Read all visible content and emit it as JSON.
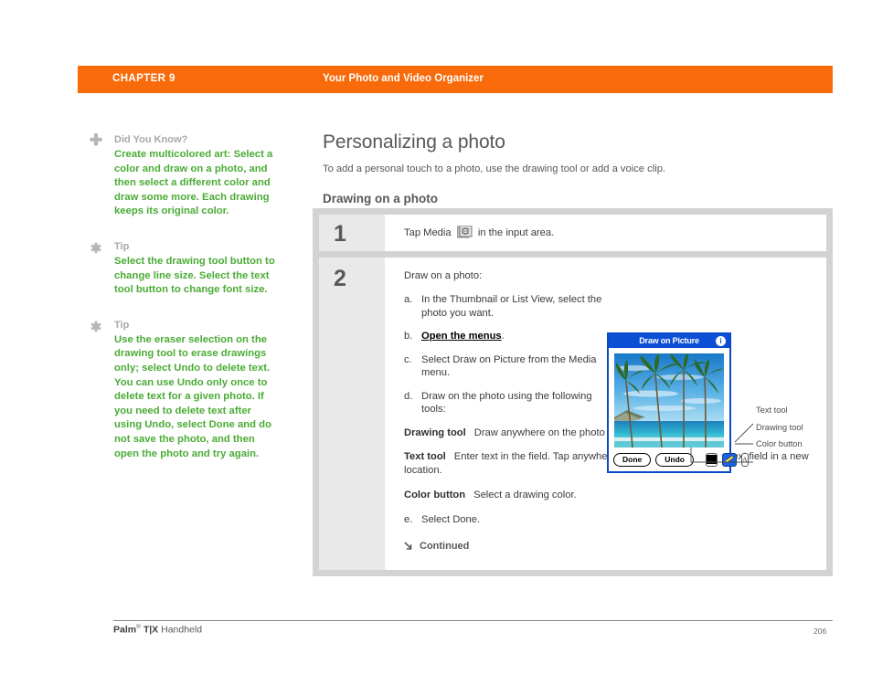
{
  "header": {
    "chapter_label": "CHAPTER 9",
    "chapter_title": "Your Photo and Video Organizer",
    "accent_color": "#f96a0a"
  },
  "sidebar": {
    "blocks": [
      {
        "icon": "plus-icon",
        "glyph": "✚",
        "heading": "Did You Know?",
        "body": "Create multicolored art: Select a color and draw on a photo, and then select a different color and draw some more. Each drawing keeps its original color."
      },
      {
        "icon": "asterisk-icon",
        "glyph": "✱",
        "heading": "Tip",
        "body": "Select the drawing tool button to change line size. Select the text tool button to change font size."
      },
      {
        "icon": "asterisk-icon",
        "glyph": "✱",
        "heading": "Tip",
        "body": "Use the eraser selection on the drawing tool to erase drawings only; select Undo to delete text. You can use Undo only once to delete text for a given photo. If you need to delete text after using Undo, select Done and do not save the photo, and then open the photo and try again."
      }
    ],
    "text_color": "#4aac35",
    "heading_color": "#a8a8a8"
  },
  "main": {
    "title": "Personalizing a photo",
    "intro": "To add a personal touch to a photo, use the drawing tool or add a voice clip.",
    "subtitle": "Drawing on a photo"
  },
  "steps": [
    {
      "number": "1",
      "text_before": "Tap Media",
      "icon": "media-icon",
      "text_after": "in the input area."
    },
    {
      "number": "2",
      "lead": "Draw on a photo:",
      "items": [
        {
          "letter": "a.",
          "text": "In the Thumbnail or List View, select the photo you want."
        },
        {
          "letter": "b.",
          "link": "Open the menus",
          "suffix": "."
        },
        {
          "letter": "c.",
          "text": "Select Draw on Picture from the Media menu."
        },
        {
          "letter": "d.",
          "text": "Draw on the photo using the following tools:"
        }
      ],
      "definitions": [
        {
          "term": "Drawing tool",
          "desc": "Draw anywhere on the photo using the stylus."
        },
        {
          "term": "Text tool",
          "desc": "Enter text in the field. Tap anywhere on the screen to open a text field in a new location."
        },
        {
          "term": "Color button",
          "desc": "Select a drawing color."
        }
      ],
      "final": {
        "letter": "e.",
        "text": "Select Done."
      },
      "continued": "Continued"
    }
  ],
  "device": {
    "title": "Draw on Picture",
    "info_glyph": "i",
    "buttons": {
      "done": "Done",
      "undo": "Undo",
      "text_tool_glyph": "A"
    },
    "title_bar_color": "#0b4fd4"
  },
  "callouts": [
    {
      "label": "Text tool"
    },
    {
      "label": "Drawing tool"
    },
    {
      "label": "Color button"
    }
  ],
  "footer": {
    "brand": "Palm",
    "registered": "®",
    "model": "T|X",
    "product": " Handheld",
    "page_number": "206"
  }
}
